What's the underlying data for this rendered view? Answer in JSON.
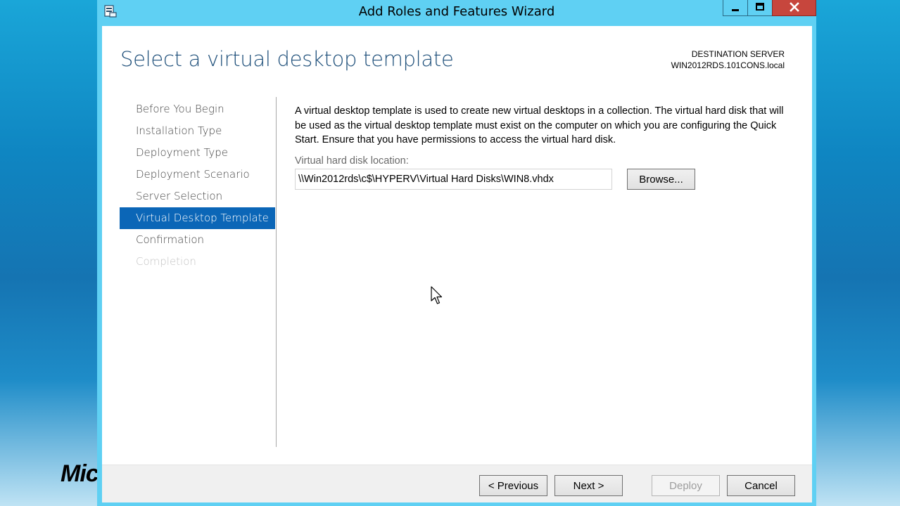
{
  "background": {
    "logo_text": "Mic"
  },
  "window": {
    "title": "Add Roles and Features Wizard",
    "controls": {
      "minimize_icon": "minimize-icon",
      "maximize_icon": "maximize-icon",
      "close_icon": "close-icon"
    }
  },
  "header": {
    "page_title": "Select a virtual desktop template",
    "destination_label": "DESTINATION SERVER",
    "destination_server": "WIN2012RDS.101CONS.local"
  },
  "nav": {
    "items": [
      {
        "label": "Before You Begin",
        "state": "normal"
      },
      {
        "label": "Installation Type",
        "state": "normal"
      },
      {
        "label": "Deployment Type",
        "state": "normal"
      },
      {
        "label": "Deployment Scenario",
        "state": "normal"
      },
      {
        "label": "Server Selection",
        "state": "normal"
      },
      {
        "label": "Virtual Desktop Template",
        "state": "active"
      },
      {
        "label": "Confirmation",
        "state": "normal"
      },
      {
        "label": "Completion",
        "state": "disabled"
      }
    ]
  },
  "main": {
    "description": "A virtual desktop template is used to create new virtual desktops in a collection. The virtual hard disk that will be used as the virtual desktop template must exist on the computer on which you are configuring the Quick Start. Ensure that you have permissions to access the virtual hard disk.",
    "vhd_label": "Virtual hard disk location:",
    "vhd_path": "\\\\Win2012rds\\c$\\HYPERV\\Virtual Hard Disks\\WIN8.vhdx",
    "browse_label": "Browse..."
  },
  "footer": {
    "previous_label": "< Previous",
    "next_label": "Next >",
    "deploy_label": "Deploy",
    "cancel_label": "Cancel"
  },
  "colors": {
    "title_bar": "#5fd0f3",
    "accent": "#0b66b7",
    "close_button": "#c7463d",
    "page_title": "#1e4f7a"
  }
}
